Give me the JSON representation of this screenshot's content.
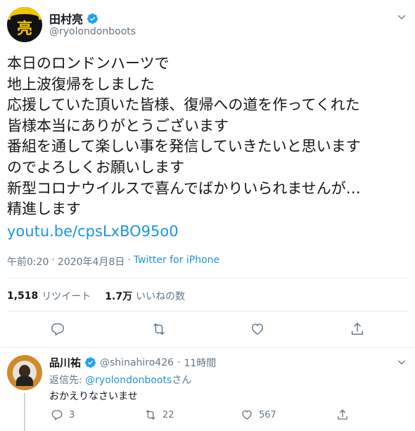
{
  "main_tweet": {
    "display_name": "田村亮",
    "handle": "@ryolondonboots",
    "avatar_glyph": "亮",
    "text": "本日のロンドンハーツで\n地上波復帰をしました\n応援していた頂いた皆様、復帰への道を作ってくれた\n皆様本当にありがとうございます\n番組を通して楽しい事を発信していきたいと思います\nのでよろしくお願いします\n新型コロナウイルスで喜んでばかりいられませんが…\n精進します",
    "link": "youtu.be/cpsLxBO95o0",
    "time": "午前0:20",
    "separator": "·",
    "date": "2020年4月8日",
    "source": "Twitter for iPhone",
    "retweet_count": "1,518",
    "retweet_label": "リツイート",
    "like_count": "1.7万",
    "like_label": "いいねの数"
  },
  "reply": {
    "display_name": "品川祐",
    "handle": "@shinahiro426",
    "separator": "·",
    "time": "11時間",
    "reply_to_prefix": "返信先:",
    "reply_to_mention": "@ryolondonboots",
    "reply_to_suffix": "さん",
    "text": "おかえりなさいませ",
    "reply_count": "3",
    "retweet_count": "22",
    "like_count": "567"
  },
  "icons": {
    "verified": "verified-badge-icon",
    "chevron": "chevron-down-icon",
    "reply": "reply-icon",
    "retweet": "retweet-icon",
    "like": "heart-icon",
    "share": "share-icon"
  },
  "colors": {
    "accent": "#1b95e0",
    "secondary_text": "#657786",
    "primary_text": "#14171a",
    "divider": "#e6ecf0"
  }
}
